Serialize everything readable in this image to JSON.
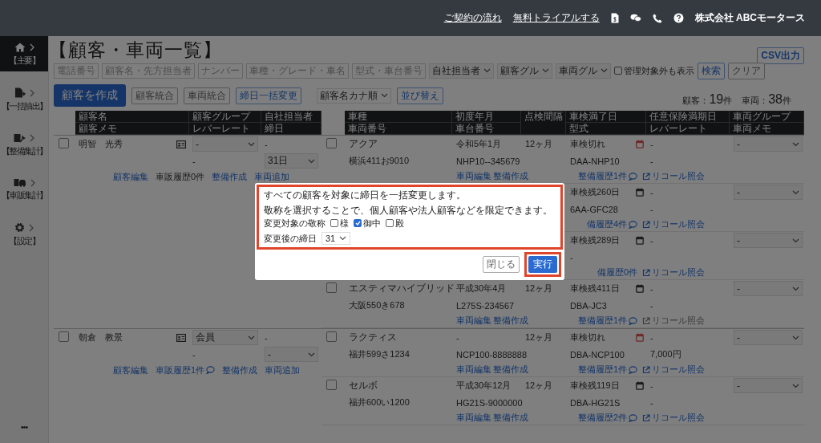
{
  "topbar": {
    "links": [
      "ご契約の流れ",
      "無料トライアルする"
    ],
    "company": "株式会社 ABCモータース"
  },
  "sidebar": {
    "items": [
      {
        "label": "【主要】",
        "kind": "home",
        "selected": true
      },
      {
        "label": "【一括抽出】",
        "kind": "export",
        "selected": false
      },
      {
        "label": "【整備集計】",
        "kind": "repair",
        "selected": false
      },
      {
        "label": "【車販集計】",
        "kind": "car",
        "selected": false
      },
      {
        "label": "【設定】",
        "kind": "gear",
        "selected": false
      }
    ],
    "more": "•••"
  },
  "page": {
    "title": "【顧客・車両一覧】",
    "csv_button": "CSV出力"
  },
  "filters": {
    "fields": [
      {
        "placeholder": "電話番号"
      },
      {
        "placeholder": "顧客名・先方担当者"
      },
      {
        "placeholder": "ナンバー"
      },
      {
        "placeholder": "車種・グレード・車名"
      },
      {
        "placeholder": "型式・車台番号"
      }
    ],
    "selects": [
      "自社担当者",
      "顧客グル",
      "車両グル"
    ],
    "checkbox": {
      "label": "管理対象外も表示",
      "checked": false
    },
    "buttons": [
      "検索",
      "クリア"
    ]
  },
  "actions": {
    "create": "顧客を作成",
    "buttons": [
      {
        "label": "顧客統合",
        "kind": "plain"
      },
      {
        "label": "車両統合",
        "kind": "plain"
      },
      {
        "label": "締日一括変更",
        "kind": "accent"
      }
    ],
    "sort_select": "顧客名カナ順",
    "sort_button": "並び替え"
  },
  "counts": [
    {
      "label": "顧客：",
      "value": "19",
      "unit": "件"
    },
    {
      "label": "車両：",
      "value": "38",
      "unit": "件"
    }
  ],
  "table": {
    "customer_columns": [
      {
        "top": "顧客名",
        "bottom": "顧客メモ"
      },
      {
        "top": "顧客グループ",
        "bottom": "レバーレート"
      },
      {
        "top": "自社担当者",
        "bottom": "締日"
      }
    ],
    "vehicle_columns": [
      {
        "top": "車種",
        "bottom": "車両番号"
      },
      {
        "top": "初度年月",
        "bottom": "車台番号"
      },
      {
        "top": "点検間隔"
      },
      {
        "top": "車検満了日",
        "bottom": "型式"
      },
      {
        "top": "任意保険満期日",
        "bottom": "レバーレート"
      },
      {
        "top": "車両グループ",
        "bottom": "車両メモ"
      }
    ],
    "customers": [
      {
        "checked": false,
        "name": "明智　光秀",
        "group": "-",
        "staff": "-",
        "leverage": "-",
        "closing_day": "31日",
        "links": [
          {
            "label": "顧客編集",
            "kind": "link"
          },
          {
            "label": "車販履歴0件",
            "kind": "text"
          },
          {
            "label": "整備作成",
            "kind": "link"
          },
          {
            "label": "車両追加",
            "kind": "link"
          }
        ],
        "vehicles": [
          {
            "checked": false,
            "name": "アクア",
            "first_reg": "令和5年1月",
            "interval": "12ヶ月",
            "inspection": "車検切れ",
            "expired": true,
            "insurance": "-",
            "group": "-",
            "plate": "横浜411お9010",
            "chassis": "NHP10--345679",
            "model": "DAA-NHP10",
            "leverage": "-",
            "links": {
              "edit": "車両編集",
              "create": "整備作成",
              "history": "整備履歴1件",
              "comments": true,
              "recall": "リコール照会",
              "recall_disabled": false
            }
          },
          {
            "inspection": "車検残260日",
            "expired": false,
            "insurance": "-",
            "group": "-",
            "model": "6AA-GFC28",
            "leverage": "-",
            "links": {
              "history": "備履歴4件",
              "comments": true,
              "recall": "リコール照会",
              "recall_disabled": false
            }
          },
          {
            "inspection": "車検残289日",
            "expired": false,
            "insurance": "-",
            "group": "-",
            "model": "-",
            "links": {
              "history": "備履歴0件",
              "comments": false,
              "recall": "リコール照会",
              "recall_disabled": false
            }
          },
          {
            "checked": false,
            "name": "エスティマハイブリッド",
            "first_reg": "平成30年4月",
            "interval": "12ヶ月",
            "inspection": "車検残411日",
            "expired": false,
            "insurance": "-",
            "group": "-",
            "plate": "大阪550き678",
            "chassis": "L275S-234567",
            "model": "DBA-JC3",
            "leverage": "-",
            "links": {
              "edit": "車両編集",
              "create": "整備作成",
              "history": "整備履歴1件",
              "comments": true,
              "recall": "リコール照会",
              "recall_disabled": true
            }
          }
        ]
      },
      {
        "checked": false,
        "name": "朝倉　教景",
        "group": "会員",
        "staff": "-",
        "leverage": "-",
        "closing_day": "-",
        "links": [
          {
            "label": "顧客編集",
            "kind": "link"
          },
          {
            "label": "車販履歴1件",
            "kind": "link_chat"
          },
          {
            "label": "整備作成",
            "kind": "link"
          },
          {
            "label": "車両追加",
            "kind": "link"
          }
        ],
        "vehicles": [
          {
            "checked": false,
            "name": "ラクティス",
            "first_reg": "-",
            "interval": "12ヶ月",
            "inspection": "車検切れ",
            "expired": true,
            "insurance": "-",
            "group": "-",
            "plate": "福井599さ1234",
            "chassis": "NCP100-8888888",
            "model": "DBA-NCP100",
            "leverage": "7,000円",
            "links": {
              "edit": "車両編集",
              "create": "整備作成",
              "history": "整備履歴1件",
              "comments": true,
              "recall": "リコール照会",
              "recall_disabled": false
            }
          },
          {
            "checked": false,
            "name": "セルボ",
            "first_reg": "平成30年12月",
            "interval": "12ヶ月",
            "inspection": "車検残119日",
            "expired": false,
            "insurance": "-",
            "group": "-",
            "plate": "福井600い1200",
            "chassis": "HG21S-9000000",
            "model": "DBA-HG21S",
            "leverage": "-",
            "links": {
              "edit": "車両編集",
              "create": "整備作成",
              "history": "整備履歴2件",
              "comments": true,
              "recall": "リコール照会",
              "recall_disabled": false
            }
          }
        ]
      }
    ]
  },
  "dialog": {
    "message": "すべての顧客を対象に締日を一括変更します。",
    "note": "敬称を選択することで、個人顧客や法人顧客などを限定できます。",
    "honorific_label": "変更対象の敬称",
    "honorifics": [
      {
        "label": "様",
        "checked": false
      },
      {
        "label": "御中",
        "checked": true
      },
      {
        "label": "殿",
        "checked": false
      }
    ],
    "day_label": "変更後の締日",
    "day_value": "31",
    "close": "閉じる",
    "run": "実行"
  }
}
